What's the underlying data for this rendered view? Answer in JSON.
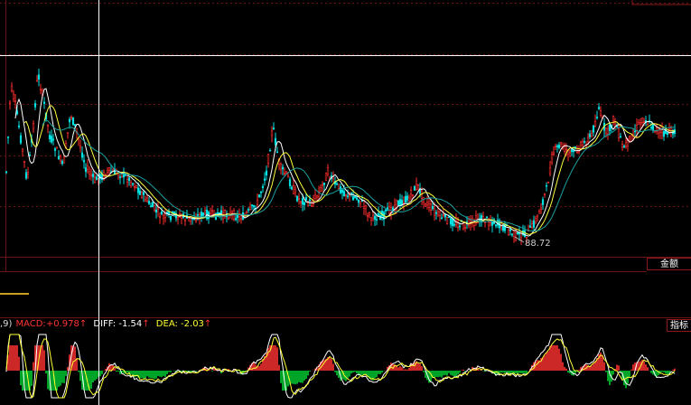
{
  "colors": {
    "background": "#000000",
    "grid": "#6b1212",
    "up": "#ff2d2d",
    "down": "#00e0e0",
    "ma1": "#ffffff",
    "ma2": "#ffff40",
    "ma3": "#1aa0a0",
    "macd_pos": "#ff3333",
    "macd_neg": "#00cc33",
    "diff_line": "#ffffff",
    "dea_line": "#ffff33",
    "crosshair": "#ffffff"
  },
  "price_panel": {
    "low_marker": "88.72",
    "right_tab": "金额"
  },
  "indicator_panel": {
    "params_fragment": ",9)",
    "macd_label": "MACD:",
    "macd_value": "+0.978",
    "diff_label": "DIFF:",
    "diff_value": "-1.54",
    "dea_label": "DEA:",
    "dea_value": "-2.03",
    "arrow": "↑",
    "right_tab": "指标"
  }
}
